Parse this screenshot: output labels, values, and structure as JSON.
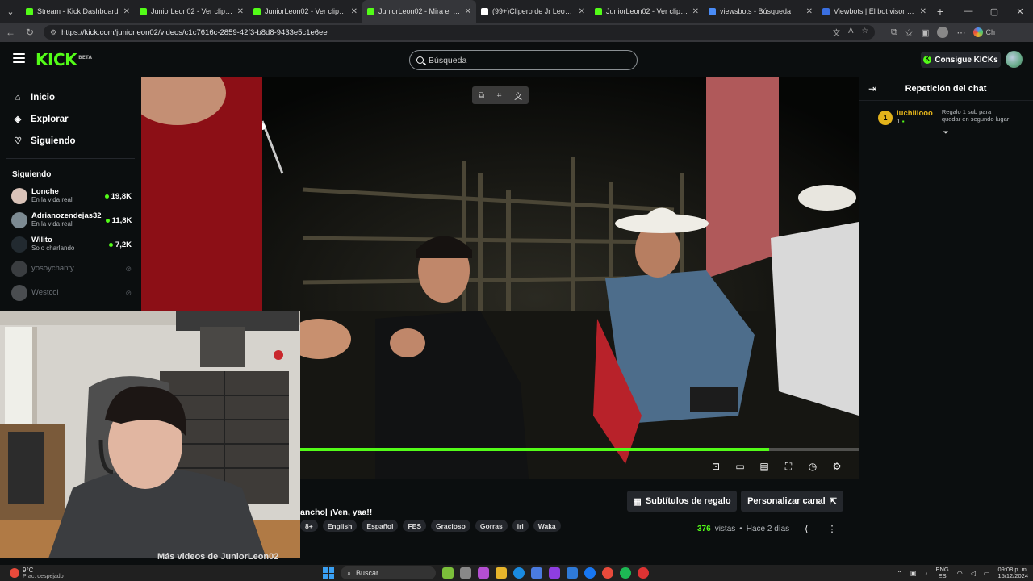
{
  "browser": {
    "tabs": [
      {
        "title": "Stream - Kick Dashboard",
        "color": "#53fc18",
        "active": false
      },
      {
        "title": "JuniorLeon02 - Ver clips en K",
        "color": "#53fc18",
        "active": false
      },
      {
        "title": "JuniorLeon02 - Ver clips en K",
        "color": "#53fc18",
        "active": false
      },
      {
        "title": "JuniorLeon02 - Mira el VOD",
        "color": "#53fc18",
        "active": true
      },
      {
        "title": "(99+)Clipero de Jr Leon (@c",
        "color": "#ffffff",
        "active": false
      },
      {
        "title": "JuniorLeon02 - Ver clips en K",
        "color": "#53fc18",
        "active": false
      },
      {
        "title": "viewsbots - Búsqueda",
        "color": "#4a8cf7",
        "active": false
      },
      {
        "title": "Viewbots | El bot visor #1 de",
        "color": "#3a6fe0",
        "active": false
      }
    ],
    "url": "https://kick.com/juniorleon02/videos/c1c7616c-2859-42f3-b8d8-9433e5c1e6ee",
    "profile_label": "Ch"
  },
  "header": {
    "logo": "KICK",
    "logo_badge": "BETA",
    "search_placeholder": "Búsqueda",
    "kicks_button": "Consigue KICKs"
  },
  "sidebar": {
    "nav": [
      {
        "label": "Inicio",
        "icon": "home-icon",
        "glyph": "⌂"
      },
      {
        "label": "Explorar",
        "icon": "compass-icon",
        "glyph": "◈"
      },
      {
        "label": "Siguiendo",
        "icon": "heart-icon",
        "glyph": "♡"
      }
    ],
    "following_title": "Siguiendo",
    "following": [
      {
        "name": "Lonche",
        "status": "En la vida real",
        "viewers": "19,8K",
        "live": true,
        "avatar": "#d9c2b8"
      },
      {
        "name": "Adrianozendejas32",
        "status": "En la vida real",
        "viewers": "11,8K",
        "live": true,
        "avatar": "#7c8a92"
      },
      {
        "name": "Wilito",
        "status": "Solo charlando",
        "viewers": "7,2K",
        "live": true,
        "avatar": "#222a30"
      },
      {
        "name": "yosoychanty",
        "status": "",
        "viewers": "",
        "live": false,
        "avatar": "#3a3d40"
      },
      {
        "name": "Westcol",
        "status": "",
        "viewers": "",
        "live": false,
        "avatar": "#4a4d50"
      }
    ]
  },
  "video": {
    "progress": 0.84,
    "controls": [
      "miniplayer-icon",
      "theater-icon",
      "captions-icon",
      "fullscreen-icon",
      "speed-icon",
      "settings-icon"
    ]
  },
  "chat": {
    "title": "Repetición del chat",
    "gift": {
      "badge": "1",
      "user": "luchillooo",
      "count": "1",
      "message": "Regalo 1 sub para quedar en segundo lugar"
    }
  },
  "details": {
    "title": "ancho| ¡Ven, yaa!!",
    "tags": [
      "8+",
      "English",
      "Español",
      "FES",
      "Gracioso",
      "Gorras",
      "irl",
      "Waka"
    ],
    "gift_subs_button": "Subtítulos de regalo",
    "customize_button": "Personalizar canal",
    "views": "376",
    "views_label": "vistas",
    "age": "Hace 2 días",
    "more_videos": "Más videos de JuniorLeon02"
  },
  "taskbar": {
    "temp": "9°C",
    "condition": "Prac. despejado",
    "search": "Buscar",
    "lang_top": "ENG",
    "lang_bottom": "ES",
    "time": "09:08 p. m.",
    "date": "15/12/2024"
  },
  "colors": {
    "accent": "#53fc18",
    "gift": "#e3b31b",
    "bg": "#0b0e0f",
    "button": "#24272c"
  }
}
